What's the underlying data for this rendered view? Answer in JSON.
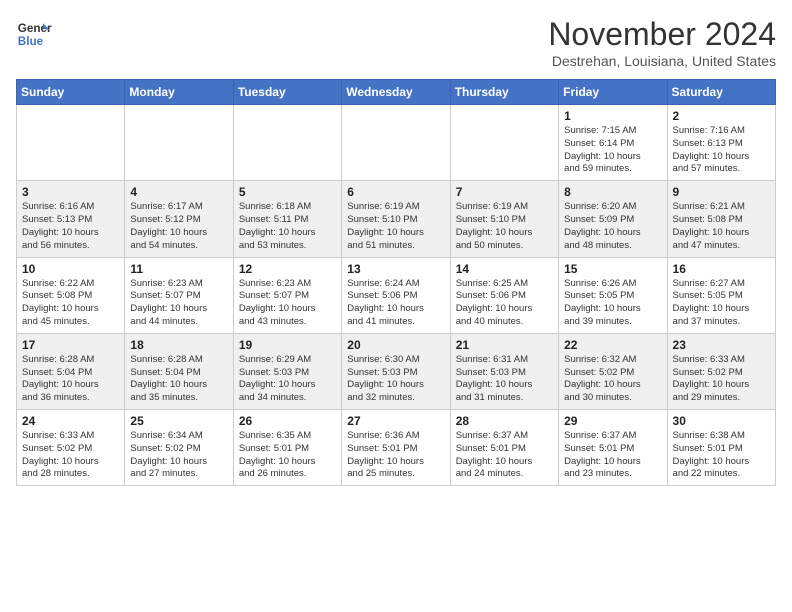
{
  "header": {
    "logo_line1": "General",
    "logo_line2": "Blue",
    "month": "November 2024",
    "location": "Destrehan, Louisiana, United States"
  },
  "weekdays": [
    "Sunday",
    "Monday",
    "Tuesday",
    "Wednesday",
    "Thursday",
    "Friday",
    "Saturday"
  ],
  "weeks": [
    [
      {
        "day": "",
        "info": ""
      },
      {
        "day": "",
        "info": ""
      },
      {
        "day": "",
        "info": ""
      },
      {
        "day": "",
        "info": ""
      },
      {
        "day": "",
        "info": ""
      },
      {
        "day": "1",
        "info": "Sunrise: 7:15 AM\nSunset: 6:14 PM\nDaylight: 10 hours\nand 59 minutes."
      },
      {
        "day": "2",
        "info": "Sunrise: 7:16 AM\nSunset: 6:13 PM\nDaylight: 10 hours\nand 57 minutes."
      }
    ],
    [
      {
        "day": "3",
        "info": "Sunrise: 6:16 AM\nSunset: 5:13 PM\nDaylight: 10 hours\nand 56 minutes."
      },
      {
        "day": "4",
        "info": "Sunrise: 6:17 AM\nSunset: 5:12 PM\nDaylight: 10 hours\nand 54 minutes."
      },
      {
        "day": "5",
        "info": "Sunrise: 6:18 AM\nSunset: 5:11 PM\nDaylight: 10 hours\nand 53 minutes."
      },
      {
        "day": "6",
        "info": "Sunrise: 6:19 AM\nSunset: 5:10 PM\nDaylight: 10 hours\nand 51 minutes."
      },
      {
        "day": "7",
        "info": "Sunrise: 6:19 AM\nSunset: 5:10 PM\nDaylight: 10 hours\nand 50 minutes."
      },
      {
        "day": "8",
        "info": "Sunrise: 6:20 AM\nSunset: 5:09 PM\nDaylight: 10 hours\nand 48 minutes."
      },
      {
        "day": "9",
        "info": "Sunrise: 6:21 AM\nSunset: 5:08 PM\nDaylight: 10 hours\nand 47 minutes."
      }
    ],
    [
      {
        "day": "10",
        "info": "Sunrise: 6:22 AM\nSunset: 5:08 PM\nDaylight: 10 hours\nand 45 minutes."
      },
      {
        "day": "11",
        "info": "Sunrise: 6:23 AM\nSunset: 5:07 PM\nDaylight: 10 hours\nand 44 minutes."
      },
      {
        "day": "12",
        "info": "Sunrise: 6:23 AM\nSunset: 5:07 PM\nDaylight: 10 hours\nand 43 minutes."
      },
      {
        "day": "13",
        "info": "Sunrise: 6:24 AM\nSunset: 5:06 PM\nDaylight: 10 hours\nand 41 minutes."
      },
      {
        "day": "14",
        "info": "Sunrise: 6:25 AM\nSunset: 5:06 PM\nDaylight: 10 hours\nand 40 minutes."
      },
      {
        "day": "15",
        "info": "Sunrise: 6:26 AM\nSunset: 5:05 PM\nDaylight: 10 hours\nand 39 minutes."
      },
      {
        "day": "16",
        "info": "Sunrise: 6:27 AM\nSunset: 5:05 PM\nDaylight: 10 hours\nand 37 minutes."
      }
    ],
    [
      {
        "day": "17",
        "info": "Sunrise: 6:28 AM\nSunset: 5:04 PM\nDaylight: 10 hours\nand 36 minutes."
      },
      {
        "day": "18",
        "info": "Sunrise: 6:28 AM\nSunset: 5:04 PM\nDaylight: 10 hours\nand 35 minutes."
      },
      {
        "day": "19",
        "info": "Sunrise: 6:29 AM\nSunset: 5:03 PM\nDaylight: 10 hours\nand 34 minutes."
      },
      {
        "day": "20",
        "info": "Sunrise: 6:30 AM\nSunset: 5:03 PM\nDaylight: 10 hours\nand 32 minutes."
      },
      {
        "day": "21",
        "info": "Sunrise: 6:31 AM\nSunset: 5:03 PM\nDaylight: 10 hours\nand 31 minutes."
      },
      {
        "day": "22",
        "info": "Sunrise: 6:32 AM\nSunset: 5:02 PM\nDaylight: 10 hours\nand 30 minutes."
      },
      {
        "day": "23",
        "info": "Sunrise: 6:33 AM\nSunset: 5:02 PM\nDaylight: 10 hours\nand 29 minutes."
      }
    ],
    [
      {
        "day": "24",
        "info": "Sunrise: 6:33 AM\nSunset: 5:02 PM\nDaylight: 10 hours\nand 28 minutes."
      },
      {
        "day": "25",
        "info": "Sunrise: 6:34 AM\nSunset: 5:02 PM\nDaylight: 10 hours\nand 27 minutes."
      },
      {
        "day": "26",
        "info": "Sunrise: 6:35 AM\nSunset: 5:01 PM\nDaylight: 10 hours\nand 26 minutes."
      },
      {
        "day": "27",
        "info": "Sunrise: 6:36 AM\nSunset: 5:01 PM\nDaylight: 10 hours\nand 25 minutes."
      },
      {
        "day": "28",
        "info": "Sunrise: 6:37 AM\nSunset: 5:01 PM\nDaylight: 10 hours\nand 24 minutes."
      },
      {
        "day": "29",
        "info": "Sunrise: 6:37 AM\nSunset: 5:01 PM\nDaylight: 10 hours\nand 23 minutes."
      },
      {
        "day": "30",
        "info": "Sunrise: 6:38 AM\nSunset: 5:01 PM\nDaylight: 10 hours\nand 22 minutes."
      }
    ]
  ]
}
